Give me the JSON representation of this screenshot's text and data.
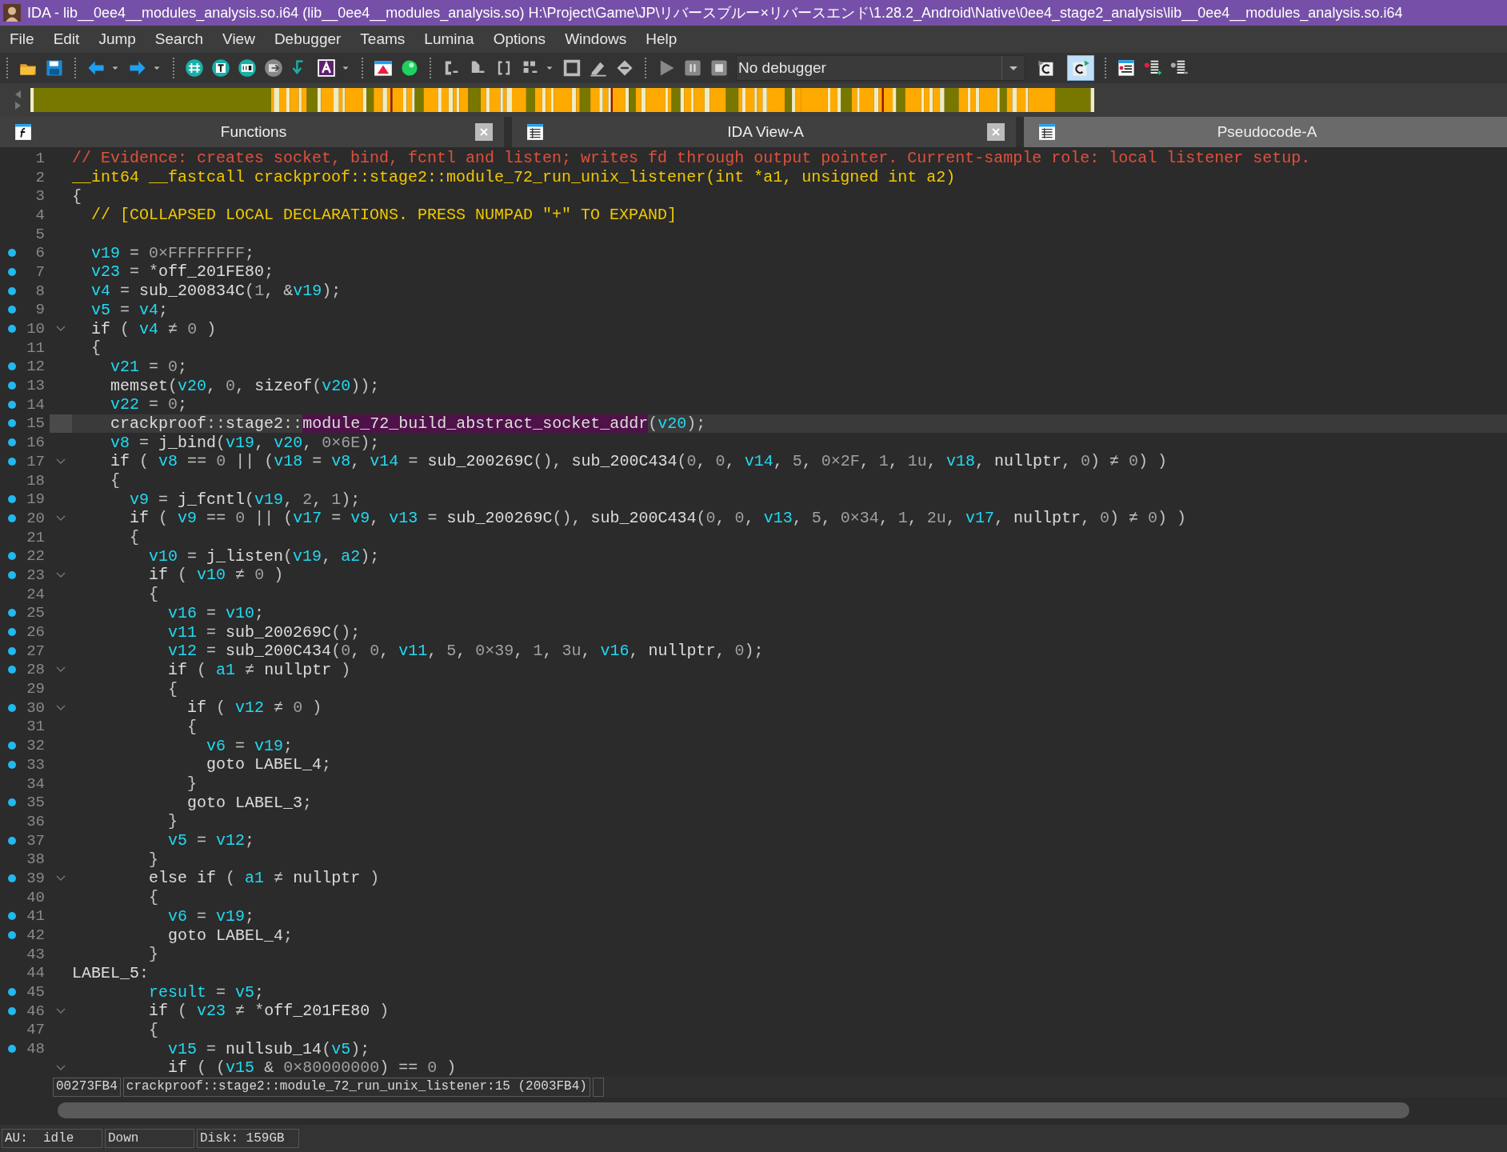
{
  "window": {
    "title": "IDA - lib__0ee4__modules_analysis.so.i64 (lib__0ee4__modules_analysis.so) H:\\Project\\Game\\JP\\リバースブルー×リバースエンド\\1.28.2_Android\\Native\\0ee4_stage2_analysis\\lib__0ee4__modules_analysis.so.i64"
  },
  "menu": [
    "File",
    "Edit",
    "Jump",
    "Search",
    "View",
    "Debugger",
    "Teams",
    "Lumina",
    "Options",
    "Windows",
    "Help"
  ],
  "toolbar": {
    "debugger_select": {
      "value": "No debugger"
    },
    "toggles": [
      {
        "on": false
      },
      {
        "on": true
      }
    ]
  },
  "tabs": [
    {
      "label": "Functions",
      "selected": false,
      "closable": true
    },
    {
      "label": "IDA View-A",
      "selected": false,
      "closable": true
    },
    {
      "label": "Pseudocode-A",
      "selected": true,
      "closable": false
    }
  ],
  "lines": [
    {
      "num": "1",
      "kind": "comment",
      "dot": false,
      "fold": false,
      "selected": false,
      "text": "// Evidence: creates socket, bind, fcntl and listen; writes fd through output pointer. Current-sample role: local listener setup."
    },
    {
      "num": "2",
      "kind": "signature",
      "dot": false,
      "fold": false,
      "selected": false,
      "text": "__int64 __fastcall crackproof::stage2::module_72_run_unix_listener(int *a1, unsigned int a2)"
    },
    {
      "num": "3",
      "kind": "code",
      "dot": false,
      "fold": false,
      "selected": false,
      "text": "{"
    },
    {
      "num": "4",
      "kind": "note",
      "dot": false,
      "fold": false,
      "selected": false,
      "text": "  // [COLLAPSED LOCAL DECLARATIONS. PRESS NUMPAD \"+\" TO EXPAND]"
    },
    {
      "num": "5",
      "kind": "code",
      "dot": false,
      "fold": false,
      "selected": false
    },
    {
      "num": "6",
      "kind": "code",
      "dot": true,
      "fold": false,
      "selected": false,
      "text": "  v19 = 0×FFFFFFFF;"
    },
    {
      "num": "7",
      "kind": "code",
      "dot": true,
      "fold": false,
      "selected": false,
      "text": "  v23 = *off_201FE80;"
    },
    {
      "num": "8",
      "kind": "code",
      "dot": true,
      "fold": false,
      "selected": false,
      "text": "  v4 = sub_200834C(1, &v19);"
    },
    {
      "num": "9",
      "kind": "code",
      "dot": true,
      "fold": false,
      "selected": false,
      "text": "  v5 = v4;"
    },
    {
      "num": "10",
      "kind": "code",
      "dot": true,
      "fold": true,
      "selected": false,
      "text": "  if ( v4 ≠ 0 )"
    },
    {
      "num": "11",
      "kind": "code",
      "dot": false,
      "fold": false,
      "selected": false,
      "text": "  {"
    },
    {
      "num": "12",
      "kind": "code",
      "dot": true,
      "fold": false,
      "selected": false,
      "text": "    v21 = 0;"
    },
    {
      "num": "13",
      "kind": "code",
      "dot": true,
      "fold": false,
      "selected": false,
      "text": "    memset(v20, 0, sizeof(v20));"
    },
    {
      "num": "14",
      "kind": "code",
      "dot": true,
      "fold": false,
      "selected": false,
      "text": "    v22 = 0;"
    },
    {
      "num": "15",
      "kind": "code",
      "dot": true,
      "fold": false,
      "selected": true,
      "parts": [
        {
          "text": "    crackproof::stage2::",
          "highlighted": false
        },
        {
          "text": "module_72_build_abstract_socket_addr",
          "highlighted": true
        },
        {
          "text": "(v20);",
          "highlighted": false
        }
      ]
    },
    {
      "num": "16",
      "kind": "code",
      "dot": true,
      "fold": false,
      "selected": false,
      "text": "    v8 = j_bind(v19, v20, 0×6E);"
    },
    {
      "num": "17",
      "kind": "code",
      "dot": true,
      "fold": true,
      "selected": false,
      "text": "    if ( v8 == 0 || (v18 = v8, v14 = sub_200269C(), sub_200C434(0, 0, v14, 5, 0×2F, 1, 1u, v18, nullptr, 0) ≠ 0) )"
    },
    {
      "num": "18",
      "kind": "code",
      "dot": false,
      "fold": false,
      "selected": false,
      "text": "    {"
    },
    {
      "num": "19",
      "kind": "code",
      "dot": true,
      "fold": false,
      "selected": false,
      "text": "      v9 = j_fcntl(v19, 2, 1);"
    },
    {
      "num": "20",
      "kind": "code",
      "dot": true,
      "fold": true,
      "selected": false,
      "text": "      if ( v9 == 0 || (v17 = v9, v13 = sub_200269C(), sub_200C434(0, 0, v13, 5, 0×34, 1, 2u, v17, nullptr, 0) ≠ 0) )"
    },
    {
      "num": "21",
      "kind": "code",
      "dot": false,
      "fold": false,
      "selected": false,
      "text": "      {"
    },
    {
      "num": "22",
      "kind": "code",
      "dot": true,
      "fold": false,
      "selected": false,
      "text": "        v10 = j_listen(v19, a2);"
    },
    {
      "num": "23",
      "kind": "code",
      "dot": true,
      "fold": true,
      "selected": false,
      "text": "        if ( v10 ≠ 0 )"
    },
    {
      "num": "24",
      "kind": "code",
      "dot": false,
      "fold": false,
      "selected": false,
      "text": "        {"
    },
    {
      "num": "25",
      "kind": "code",
      "dot": true,
      "fold": false,
      "selected": false,
      "text": "          v16 = v10;"
    },
    {
      "num": "26",
      "kind": "code",
      "dot": true,
      "fold": false,
      "selected": false,
      "text": "          v11 = sub_200269C();"
    },
    {
      "num": "27",
      "kind": "code",
      "dot": true,
      "fold": false,
      "selected": false,
      "text": "          v12 = sub_200C434(0, 0, v11, 5, 0×39, 1, 3u, v16, nullptr, 0);"
    },
    {
      "num": "28",
      "kind": "code",
      "dot": true,
      "fold": true,
      "selected": false,
      "text": "          if ( a1 ≠ nullptr )"
    },
    {
      "num": "29",
      "kind": "code",
      "dot": false,
      "fold": false,
      "selected": false,
      "text": "          {"
    },
    {
      "num": "30",
      "kind": "code",
      "dot": true,
      "fold": true,
      "selected": false,
      "text": "            if ( v12 ≠ 0 )"
    },
    {
      "num": "31",
      "kind": "code",
      "dot": false,
      "fold": false,
      "selected": false,
      "text": "            {"
    },
    {
      "num": "32",
      "kind": "code",
      "dot": true,
      "fold": false,
      "selected": false,
      "text": "              v6 = v19;"
    },
    {
      "num": "33",
      "kind": "code",
      "dot": true,
      "fold": false,
      "selected": false,
      "text": "              goto LABEL_4;"
    },
    {
      "num": "34",
      "kind": "code",
      "dot": false,
      "fold": false,
      "selected": false,
      "text": "            }"
    },
    {
      "num": "35",
      "kind": "code",
      "dot": true,
      "fold": false,
      "selected": false,
      "text": "            goto LABEL_3;"
    },
    {
      "num": "36",
      "kind": "code",
      "dot": false,
      "fold": false,
      "selected": false,
      "text": "          }"
    },
    {
      "num": "37",
      "kind": "code",
      "dot": true,
      "fold": false,
      "selected": false,
      "text": "          v5 = v12;"
    },
    {
      "num": "38",
      "kind": "code",
      "dot": false,
      "fold": false,
      "selected": false,
      "text": "        }"
    },
    {
      "num": "39",
      "kind": "code",
      "dot": true,
      "fold": true,
      "selected": false,
      "text": "        else if ( a1 ≠ nullptr )"
    },
    {
      "num": "40",
      "kind": "code",
      "dot": false,
      "fold": false,
      "selected": false,
      "text": "        {"
    },
    {
      "num": "41",
      "kind": "code",
      "dot": true,
      "fold": false,
      "selected": false,
      "text": "          v6 = v19;"
    },
    {
      "num": "42",
      "kind": "code",
      "dot": true,
      "fold": false,
      "selected": false,
      "text": "          goto LABEL_4;"
    },
    {
      "num": "43",
      "kind": "code",
      "dot": false,
      "fold": false,
      "selected": false,
      "text": "        }"
    },
    {
      "num": "44",
      "kind": "code",
      "dot": false,
      "fold": false,
      "selected": false,
      "text": "LABEL_5:"
    },
    {
      "num": "45",
      "kind": "code",
      "dot": true,
      "fold": false,
      "selected": false,
      "text": "        result = v5;"
    },
    {
      "num": "46",
      "kind": "code",
      "dot": true,
      "fold": true,
      "selected": false,
      "text": "        if ( v23 ≠ *off_201FE80 )"
    },
    {
      "num": "47",
      "kind": "code",
      "dot": false,
      "fold": false,
      "selected": false,
      "text": "        {"
    },
    {
      "num": "48",
      "kind": "code",
      "dot": true,
      "fold": false,
      "selected": false,
      "text": "          v15 = nullsub_14(v5);"
    },
    {
      "kind": "code",
      "dot": false,
      "fold": true,
      "selected": false,
      "text": "          if ( (v15 & 0×80000000) == 0 )"
    }
  ],
  "location": {
    "address": "00273FB4",
    "function": "crackproof::stage2::module_72_run_unix_listener:15 (2003FB4)"
  },
  "status_bar": [
    "AU:  idle",
    "Down",
    "Disk: 159GB"
  ]
}
